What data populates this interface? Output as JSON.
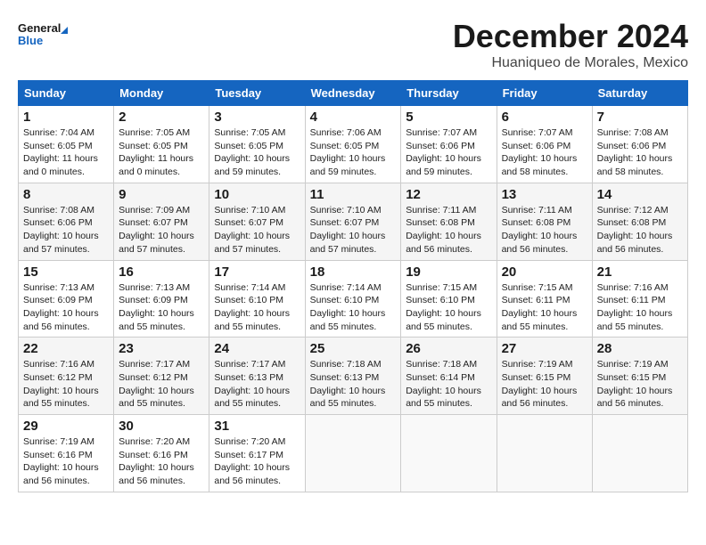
{
  "logo": {
    "line1": "General",
    "line2": "Blue"
  },
  "title": "December 2024",
  "location": "Huaniqueo de Morales, Mexico",
  "days_of_week": [
    "Sunday",
    "Monday",
    "Tuesday",
    "Wednesday",
    "Thursday",
    "Friday",
    "Saturday"
  ],
  "weeks": [
    [
      {
        "day": "1",
        "sunrise": "7:04 AM",
        "sunset": "6:05 PM",
        "daylight": "11 hours and 0 minutes."
      },
      {
        "day": "2",
        "sunrise": "7:05 AM",
        "sunset": "6:05 PM",
        "daylight": "11 hours and 0 minutes."
      },
      {
        "day": "3",
        "sunrise": "7:05 AM",
        "sunset": "6:05 PM",
        "daylight": "10 hours and 59 minutes."
      },
      {
        "day": "4",
        "sunrise": "7:06 AM",
        "sunset": "6:05 PM",
        "daylight": "10 hours and 59 minutes."
      },
      {
        "day": "5",
        "sunrise": "7:07 AM",
        "sunset": "6:06 PM",
        "daylight": "10 hours and 59 minutes."
      },
      {
        "day": "6",
        "sunrise": "7:07 AM",
        "sunset": "6:06 PM",
        "daylight": "10 hours and 58 minutes."
      },
      {
        "day": "7",
        "sunrise": "7:08 AM",
        "sunset": "6:06 PM",
        "daylight": "10 hours and 58 minutes."
      }
    ],
    [
      {
        "day": "8",
        "sunrise": "7:08 AM",
        "sunset": "6:06 PM",
        "daylight": "10 hours and 57 minutes."
      },
      {
        "day": "9",
        "sunrise": "7:09 AM",
        "sunset": "6:07 PM",
        "daylight": "10 hours and 57 minutes."
      },
      {
        "day": "10",
        "sunrise": "7:10 AM",
        "sunset": "6:07 PM",
        "daylight": "10 hours and 57 minutes."
      },
      {
        "day": "11",
        "sunrise": "7:10 AM",
        "sunset": "6:07 PM",
        "daylight": "10 hours and 57 minutes."
      },
      {
        "day": "12",
        "sunrise": "7:11 AM",
        "sunset": "6:08 PM",
        "daylight": "10 hours and 56 minutes."
      },
      {
        "day": "13",
        "sunrise": "7:11 AM",
        "sunset": "6:08 PM",
        "daylight": "10 hours and 56 minutes."
      },
      {
        "day": "14",
        "sunrise": "7:12 AM",
        "sunset": "6:08 PM",
        "daylight": "10 hours and 56 minutes."
      }
    ],
    [
      {
        "day": "15",
        "sunrise": "7:13 AM",
        "sunset": "6:09 PM",
        "daylight": "10 hours and 56 minutes."
      },
      {
        "day": "16",
        "sunrise": "7:13 AM",
        "sunset": "6:09 PM",
        "daylight": "10 hours and 55 minutes."
      },
      {
        "day": "17",
        "sunrise": "7:14 AM",
        "sunset": "6:10 PM",
        "daylight": "10 hours and 55 minutes."
      },
      {
        "day": "18",
        "sunrise": "7:14 AM",
        "sunset": "6:10 PM",
        "daylight": "10 hours and 55 minutes."
      },
      {
        "day": "19",
        "sunrise": "7:15 AM",
        "sunset": "6:10 PM",
        "daylight": "10 hours and 55 minutes."
      },
      {
        "day": "20",
        "sunrise": "7:15 AM",
        "sunset": "6:11 PM",
        "daylight": "10 hours and 55 minutes."
      },
      {
        "day": "21",
        "sunrise": "7:16 AM",
        "sunset": "6:11 PM",
        "daylight": "10 hours and 55 minutes."
      }
    ],
    [
      {
        "day": "22",
        "sunrise": "7:16 AM",
        "sunset": "6:12 PM",
        "daylight": "10 hours and 55 minutes."
      },
      {
        "day": "23",
        "sunrise": "7:17 AM",
        "sunset": "6:12 PM",
        "daylight": "10 hours and 55 minutes."
      },
      {
        "day": "24",
        "sunrise": "7:17 AM",
        "sunset": "6:13 PM",
        "daylight": "10 hours and 55 minutes."
      },
      {
        "day": "25",
        "sunrise": "7:18 AM",
        "sunset": "6:13 PM",
        "daylight": "10 hours and 55 minutes."
      },
      {
        "day": "26",
        "sunrise": "7:18 AM",
        "sunset": "6:14 PM",
        "daylight": "10 hours and 55 minutes."
      },
      {
        "day": "27",
        "sunrise": "7:19 AM",
        "sunset": "6:15 PM",
        "daylight": "10 hours and 56 minutes."
      },
      {
        "day": "28",
        "sunrise": "7:19 AM",
        "sunset": "6:15 PM",
        "daylight": "10 hours and 56 minutes."
      }
    ],
    [
      {
        "day": "29",
        "sunrise": "7:19 AM",
        "sunset": "6:16 PM",
        "daylight": "10 hours and 56 minutes."
      },
      {
        "day": "30",
        "sunrise": "7:20 AM",
        "sunset": "6:16 PM",
        "daylight": "10 hours and 56 minutes."
      },
      {
        "day": "31",
        "sunrise": "7:20 AM",
        "sunset": "6:17 PM",
        "daylight": "10 hours and 56 minutes."
      },
      null,
      null,
      null,
      null
    ]
  ]
}
